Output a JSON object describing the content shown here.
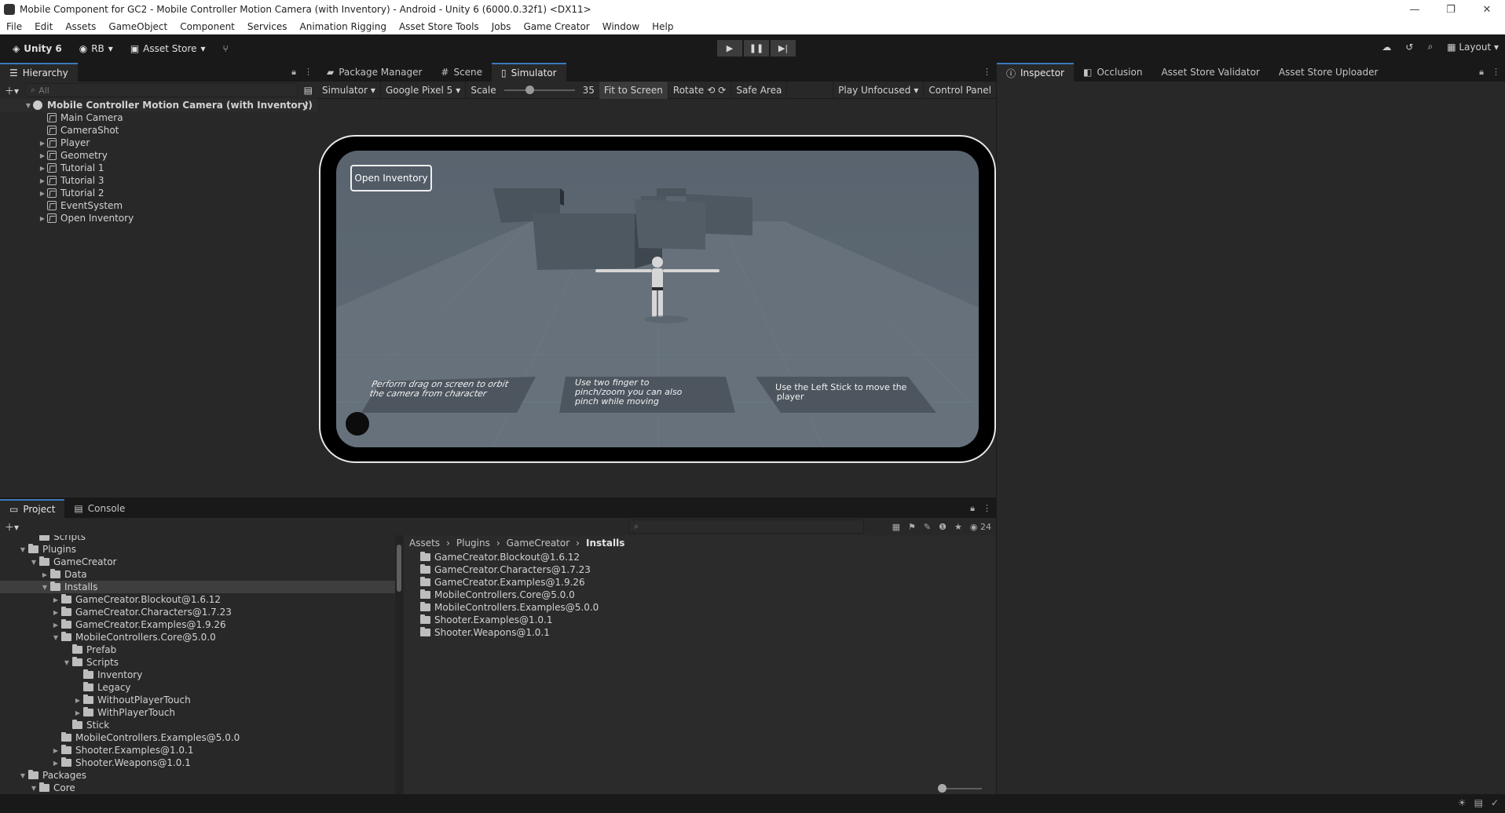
{
  "window": {
    "title": "Mobile Component for GC2 - Mobile Controller Motion Camera (with Inventory) - Android - Unity 6 (6000.0.32f1) <DX11>"
  },
  "menu": [
    "File",
    "Edit",
    "Assets",
    "GameObject",
    "Component",
    "Services",
    "Animation Rigging",
    "Asset Store Tools",
    "Jobs",
    "Game Creator",
    "Window",
    "Help"
  ],
  "toolbar": {
    "unity_label": "Unity 6",
    "account_label": "RB",
    "asset_store_label": "Asset Store",
    "layout_label": "Layout"
  },
  "hierarchy": {
    "tab_label": "Hierarchy",
    "search_placeholder": "All",
    "root": "Mobile Controller Motion Camera (with Inventory)",
    "items": [
      {
        "label": "Main Camera",
        "expandable": false
      },
      {
        "label": "CameraShot",
        "expandable": false
      },
      {
        "label": "Player",
        "expandable": true
      },
      {
        "label": "Geometry",
        "expandable": true
      },
      {
        "label": "Tutorial 1",
        "expandable": true
      },
      {
        "label": "Tutorial 3",
        "expandable": true
      },
      {
        "label": "Tutorial 2",
        "expandable": true
      },
      {
        "label": "EventSystem",
        "expandable": false
      },
      {
        "label": "Open Inventory",
        "expandable": true
      }
    ]
  },
  "center_tabs": {
    "package_manager": "Package Manager",
    "scene": "Scene",
    "simulator": "Simulator"
  },
  "simulator": {
    "mode": "Simulator",
    "device": "Google Pixel 5",
    "scale_label": "Scale",
    "scale_value": "35",
    "fit_label": "Fit to Screen",
    "rotate_label": "Rotate",
    "safe_area_label": "Safe Area",
    "play_mode": "Play Unfocused",
    "control_panel": "Control Panel",
    "open_inventory": "Open Inventory",
    "tutorials": [
      "Perform drag on screen to orbit the camera from character",
      "Use two finger to pinch/zoom you can also pinch while moving",
      "Use the Left Stick to move the player"
    ]
  },
  "inspector_tabs": {
    "inspector": "Inspector",
    "occlusion": "Occlusion",
    "validator": "Asset Store Validator",
    "uploader": "Asset Store Uploader"
  },
  "project": {
    "tab_label": "Project",
    "console_label": "Console",
    "hidden_count": "24",
    "tree": [
      {
        "label": "Scripts",
        "indent": 2,
        "arrow": ""
      },
      {
        "label": "Plugins",
        "indent": 1,
        "arrow": "▼"
      },
      {
        "label": "GameCreator",
        "indent": 2,
        "arrow": "▼"
      },
      {
        "label": "Data",
        "indent": 3,
        "arrow": "▶"
      },
      {
        "label": "Installs",
        "indent": 3,
        "arrow": "▼",
        "selected": true
      },
      {
        "label": "GameCreator.Blockout@1.6.12",
        "indent": 4,
        "arrow": "▶"
      },
      {
        "label": "GameCreator.Characters@1.7.23",
        "indent": 4,
        "arrow": "▶"
      },
      {
        "label": "GameCreator.Examples@1.9.26",
        "indent": 4,
        "arrow": "▶"
      },
      {
        "label": "MobileControllers.Core@5.0.0",
        "indent": 4,
        "arrow": "▼"
      },
      {
        "label": "Prefab",
        "indent": 5,
        "arrow": ""
      },
      {
        "label": "Scripts",
        "indent": 5,
        "arrow": "▼"
      },
      {
        "label": "Inventory",
        "indent": 6,
        "arrow": ""
      },
      {
        "label": "Legacy",
        "indent": 6,
        "arrow": ""
      },
      {
        "label": "WithoutPlayerTouch",
        "indent": 6,
        "arrow": "▶"
      },
      {
        "label": "WithPlayerTouch",
        "indent": 6,
        "arrow": "▶"
      },
      {
        "label": "Stick",
        "indent": 5,
        "arrow": ""
      },
      {
        "label": "MobileControllers.Examples@5.0.0",
        "indent": 4,
        "arrow": ""
      },
      {
        "label": "Shooter.Examples@1.0.1",
        "indent": 4,
        "arrow": "▶"
      },
      {
        "label": "Shooter.Weapons@1.0.1",
        "indent": 4,
        "arrow": "▶"
      },
      {
        "label": "Packages",
        "indent": 1,
        "arrow": "▼"
      },
      {
        "label": "Core",
        "indent": 2,
        "arrow": "▼"
      }
    ],
    "breadcrumbs": [
      "Assets",
      "Plugins",
      "GameCreator",
      "Installs"
    ],
    "files": [
      "GameCreator.Blockout@1.6.12",
      "GameCreator.Characters@1.7.23",
      "GameCreator.Examples@1.9.26",
      "MobileControllers.Core@5.0.0",
      "MobileControllers.Examples@5.0.0",
      "Shooter.Examples@1.0.1",
      "Shooter.Weapons@1.0.1"
    ]
  }
}
